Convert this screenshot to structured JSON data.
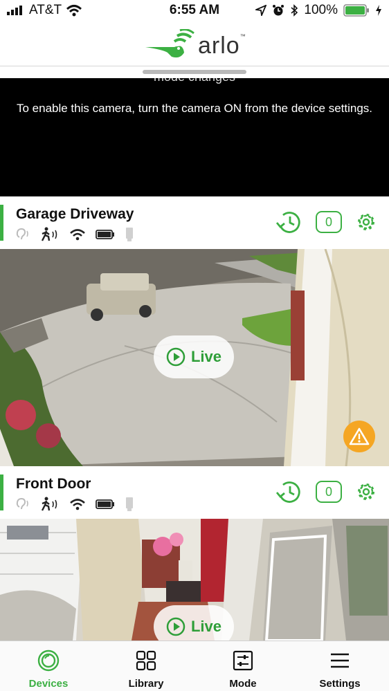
{
  "status_bar": {
    "carrier": "AT&T",
    "time": "6:55 AM",
    "battery": "100%"
  },
  "header": {
    "logo_text": "arlo",
    "logo_tm": "™"
  },
  "disabled_panel": {
    "cut_text": "mode changes",
    "message": "To enable this camera, turn the camera ON from the device settings."
  },
  "devices": [
    {
      "name": "Garage Driveway",
      "motion_count": "0",
      "live_label": "Live"
    },
    {
      "name": "Front Door",
      "motion_count": "0",
      "live_label": "Live"
    }
  ],
  "tabs": [
    {
      "label": "Devices",
      "icon": "devices-icon",
      "active": true
    },
    {
      "label": "Library",
      "icon": "library-icon",
      "active": false
    },
    {
      "label": "Mode",
      "icon": "mode-icon",
      "active": false
    },
    {
      "label": "Settings",
      "icon": "settings-menu-icon",
      "active": false
    }
  ],
  "colors": {
    "accent": "#3cb043",
    "warning": "#f5a623"
  }
}
